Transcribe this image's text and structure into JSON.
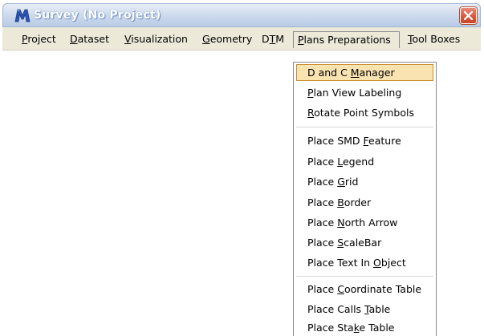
{
  "window": {
    "title": "Survey (No Project)",
    "icon": "microstation-m-icon",
    "close_icon": "close-x-icon"
  },
  "menubar": {
    "items": [
      {
        "pre": "",
        "ul": "P",
        "post": "roject"
      },
      {
        "pre": "",
        "ul": "D",
        "post": "ataset"
      },
      {
        "pre": "",
        "ul": "V",
        "post": "isualization"
      },
      {
        "pre": "",
        "ul": "G",
        "post": "eometry"
      },
      {
        "pre": "D",
        "ul": "T",
        "post": "M"
      },
      {
        "pre": "",
        "ul": "P",
        "post": "lans Preparations"
      },
      {
        "pre": "",
        "ul": "T",
        "post": "ool Boxes"
      }
    ],
    "open_index": 5
  },
  "dropdown": {
    "groups": [
      [
        {
          "pre": "D and C ",
          "ul": "M",
          "post": "anager",
          "selected": true
        },
        {
          "pre": "",
          "ul": "P",
          "post": "lan View Labeling"
        },
        {
          "pre": "",
          "ul": "R",
          "post": "otate Point Symbols"
        }
      ],
      [
        {
          "pre": "Place SMD ",
          "ul": "F",
          "post": "eature"
        },
        {
          "pre": "Place ",
          "ul": "L",
          "post": "egend"
        },
        {
          "pre": "Place ",
          "ul": "G",
          "post": "rid"
        },
        {
          "pre": "Place ",
          "ul": "B",
          "post": "order"
        },
        {
          "pre": "Place ",
          "ul": "N",
          "post": "orth Arrow"
        },
        {
          "pre": "Place ",
          "ul": "S",
          "post": "caleBar"
        },
        {
          "pre": "Place Text In ",
          "ul": "O",
          "post": "bject"
        }
      ],
      [
        {
          "pre": "Place ",
          "ul": "C",
          "post": "oordinate Table"
        },
        {
          "pre": "Place Calls ",
          "ul": "T",
          "post": "able"
        },
        {
          "pre": "Place Sta",
          "ul": "k",
          "post": "e Table"
        }
      ]
    ]
  },
  "colors": {
    "titlebar": "#c7d6ec",
    "menubar": "#ece9d8",
    "selected_bg": "#f9e3b1",
    "selected_border": "#c98a2a",
    "close_button": "#d7593e"
  }
}
